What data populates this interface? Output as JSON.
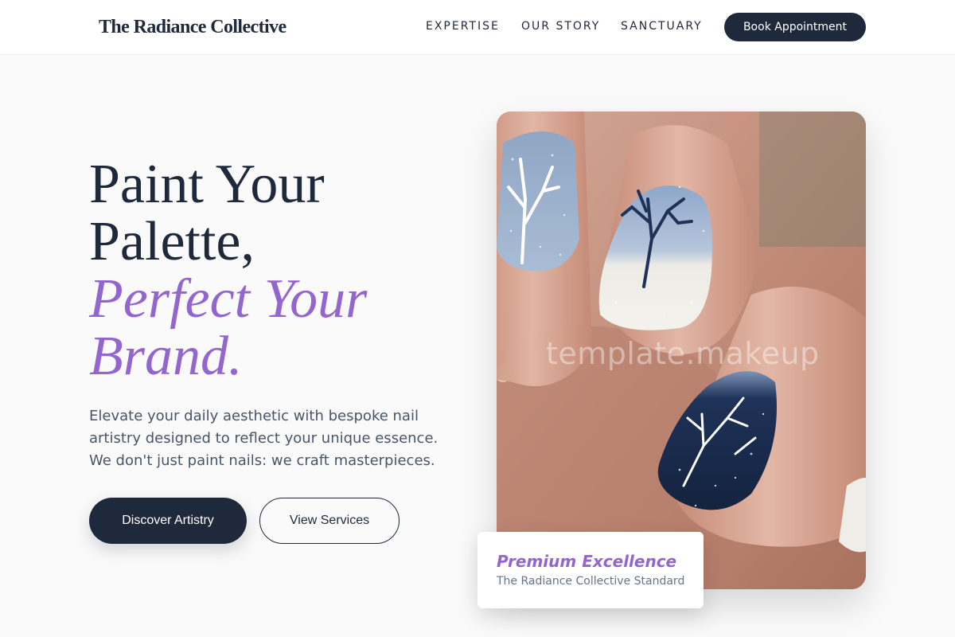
{
  "brand": {
    "name": "The Radiance Collective"
  },
  "nav": {
    "links": [
      {
        "label": "EXPERTISE"
      },
      {
        "label": "OUR STORY"
      },
      {
        "label": "SANCTUARY"
      }
    ],
    "cta_label": "Book Appointment"
  },
  "hero": {
    "title_lines": [
      "Paint Your",
      "Palette,"
    ],
    "accent_lines": [
      "Perfect Your",
      "Brand."
    ],
    "description_lines": [
      "Elevate your daily aesthetic with bespoke nail",
      "artistry designed to reflect your unique essence.",
      "We don't just paint nails: we craft masterpieces."
    ],
    "primary_button": "Discover Artistry",
    "secondary_button": "View Services",
    "image": {
      "subject": "manicured hand with winter tree nail art in blue, white and navy",
      "watermark": "template.makeup"
    }
  },
  "badge_card": {
    "title": "Premium Excellence",
    "subtitle": "The Radiance Collective Standard"
  },
  "colors": {
    "navy": "#1e293b",
    "accent_purple": "#9366cf",
    "background": "#fafafa",
    "body_text": "#475569",
    "muted_text": "#64748b"
  }
}
